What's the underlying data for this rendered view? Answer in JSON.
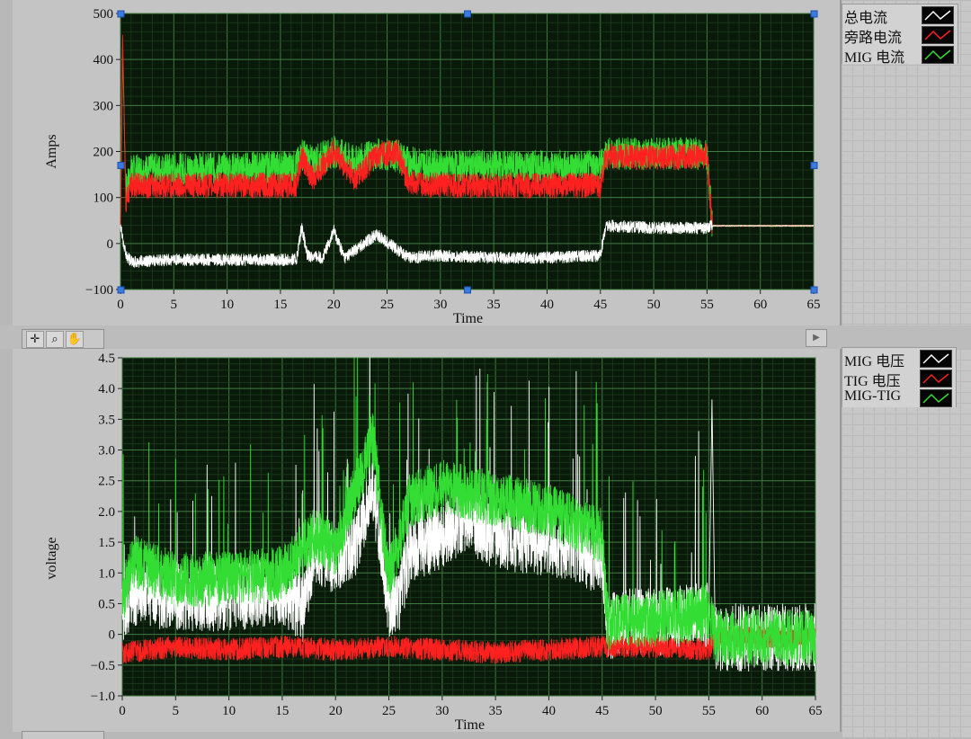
{
  "upper_legend": [
    {
      "label": "总电流",
      "color": "#ffffff"
    },
    {
      "label": "旁路电流",
      "color": "#ff2020"
    },
    {
      "label": "MIG 电流",
      "color": "#33dd33"
    }
  ],
  "lower_legend": [
    {
      "label": "MIG 电压",
      "color": "#ffffff"
    },
    {
      "label": "TIG 电压",
      "color": "#ff2020"
    },
    {
      "label": "MIG-TIG",
      "color": "#33dd33"
    }
  ],
  "toolbar": {
    "cursor_icon": "crosshair-icon",
    "zoom_icon": "zoom-icon",
    "pan_icon": "hand-icon"
  },
  "chart_data": [
    {
      "type": "line",
      "xlabel": "Time",
      "ylabel": "Amps",
      "xlim": [
        0,
        65
      ],
      "ylim": [
        -150,
        500
      ],
      "x_ticks": [
        "0",
        "5",
        "10",
        "15",
        "20",
        "25",
        "30",
        "35",
        "40",
        "45",
        "50",
        "55",
        "60",
        "65"
      ],
      "y_ticks": [
        "500",
        "400",
        "300",
        "200",
        "100",
        "0",
        "−100"
      ],
      "grid": true,
      "plot_background": "#0a1a0a",
      "series": [
        {
          "name": "MIG 电流",
          "color": "#33dd33",
          "points": [
            [
              0,
              0
            ],
            [
              0.2,
              420
            ],
            [
              0.5,
              80
            ],
            [
              1,
              130
            ],
            [
              5,
              135
            ],
            [
              10,
              135
            ],
            [
              16.5,
              140
            ],
            [
              17,
              170
            ],
            [
              18,
              150
            ],
            [
              20,
              175
            ],
            [
              22,
              150
            ],
            [
              24,
              170
            ],
            [
              26,
              165
            ],
            [
              27,
              150
            ],
            [
              30,
              140
            ],
            [
              35,
              140
            ],
            [
              40,
              140
            ],
            [
              45,
              140
            ],
            [
              45.5,
              170
            ],
            [
              50,
              170
            ],
            [
              55,
              170
            ],
            [
              55.5,
              0
            ],
            [
              65,
              0
            ]
          ]
        },
        {
          "name": "旁路电流",
          "color": "#ff2020",
          "points": [
            [
              0,
              0
            ],
            [
              0.2,
              450
            ],
            [
              0.5,
              60
            ],
            [
              1,
              95
            ],
            [
              5,
              95
            ],
            [
              10,
              95
            ],
            [
              16.5,
              95
            ],
            [
              17,
              165
            ],
            [
              18,
              110
            ],
            [
              20,
              175
            ],
            [
              22,
              110
            ],
            [
              24,
              165
            ],
            [
              26,
              175
            ],
            [
              27,
              100
            ],
            [
              30,
              95
            ],
            [
              35,
              95
            ],
            [
              40,
              95
            ],
            [
              45,
              95
            ],
            [
              45.5,
              165
            ],
            [
              50,
              160
            ],
            [
              55,
              165
            ],
            [
              55.5,
              0
            ],
            [
              65,
              0
            ]
          ]
        },
        {
          "name": "总电流",
          "color": "#ffffff",
          "points": [
            [
              0,
              0
            ],
            [
              0.5,
              -70
            ],
            [
              1,
              -85
            ],
            [
              5,
              -80
            ],
            [
              10,
              -80
            ],
            [
              16.5,
              -80
            ],
            [
              17,
              0
            ],
            [
              17.5,
              -70
            ],
            [
              19,
              -75
            ],
            [
              20,
              -10
            ],
            [
              21,
              -75
            ],
            [
              24,
              -20
            ],
            [
              27,
              -75
            ],
            [
              30,
              -70
            ],
            [
              35,
              -75
            ],
            [
              40,
              -75
            ],
            [
              45,
              -70
            ],
            [
              45.5,
              0
            ],
            [
              50,
              -5
            ],
            [
              55,
              -5
            ],
            [
              55.5,
              0
            ],
            [
              65,
              0
            ]
          ]
        }
      ]
    },
    {
      "type": "line",
      "xlabel": "Time",
      "ylabel": "voltage",
      "xlim": [
        0,
        65
      ],
      "ylim": [
        -1.0,
        4.5
      ],
      "x_ticks": [
        "0",
        "5",
        "10",
        "15",
        "20",
        "25",
        "30",
        "35",
        "40",
        "45",
        "50",
        "55",
        "60",
        "65"
      ],
      "y_ticks": [
        "4.5",
        "4.0",
        "3.5",
        "3.0",
        "2.5",
        "2.0",
        "1.5",
        "1.0",
        "0.5",
        "0",
        "−0.5",
        "−1.0"
      ],
      "grid": true,
      "plot_background": "#0a1a0a",
      "series": [
        {
          "name": "MIG 电压",
          "color": "#ffffff",
          "points": [
            [
              0,
              0.3
            ],
            [
              1,
              0.7
            ],
            [
              5,
              0.6
            ],
            [
              10,
              0.6
            ],
            [
              15,
              0.7
            ],
            [
              17,
              0.4
            ],
            [
              18,
              1.4
            ],
            [
              20,
              1.2
            ],
            [
              22,
              1.5
            ],
            [
              23.5,
              2.4
            ],
            [
              25,
              0.5
            ],
            [
              26,
              0.6
            ],
            [
              27,
              1.4
            ],
            [
              30,
              1.6
            ],
            [
              32,
              1.9
            ],
            [
              35,
              1.6
            ],
            [
              40,
              1.5
            ],
            [
              45,
              1.2
            ],
            [
              45.5,
              0.15
            ],
            [
              48,
              0.2
            ],
            [
              50,
              0.2
            ],
            [
              55,
              0.3
            ],
            [
              55.3,
              3.8
            ],
            [
              55.6,
              -0.05
            ],
            [
              65,
              -0.05
            ]
          ]
        },
        {
          "name": "TIG 电压",
          "color": "#ff2020",
          "points": [
            [
              0,
              -0.3
            ],
            [
              5,
              -0.2
            ],
            [
              10,
              -0.25
            ],
            [
              15,
              -0.2
            ],
            [
              20,
              -0.25
            ],
            [
              25,
              -0.2
            ],
            [
              30,
              -0.25
            ],
            [
              35,
              -0.3
            ],
            [
              40,
              -0.25
            ],
            [
              45,
              -0.2
            ],
            [
              50,
              -0.2
            ],
            [
              55,
              -0.25
            ],
            [
              55.6,
              -0.05
            ],
            [
              65,
              -0.05
            ]
          ]
        },
        {
          "name": "MIG-TIG",
          "color": "#33dd33",
          "points": [
            [
              0,
              0.6
            ],
            [
              1,
              1.2
            ],
            [
              5,
              0.9
            ],
            [
              10,
              0.9
            ],
            [
              15,
              1.0
            ],
            [
              18,
              1.6
            ],
            [
              20,
              1.4
            ],
            [
              23.5,
              3.2
            ],
            [
              25,
              0.9
            ],
            [
              27,
              2.2
            ],
            [
              30,
              2.4
            ],
            [
              35,
              2.2
            ],
            [
              40,
              2.0
            ],
            [
              45,
              1.6
            ],
            [
              45.5,
              0.2
            ],
            [
              50,
              0.25
            ],
            [
              55,
              0.35
            ],
            [
              55.6,
              -0.05
            ],
            [
              65,
              -0.05
            ]
          ]
        }
      ]
    }
  ]
}
